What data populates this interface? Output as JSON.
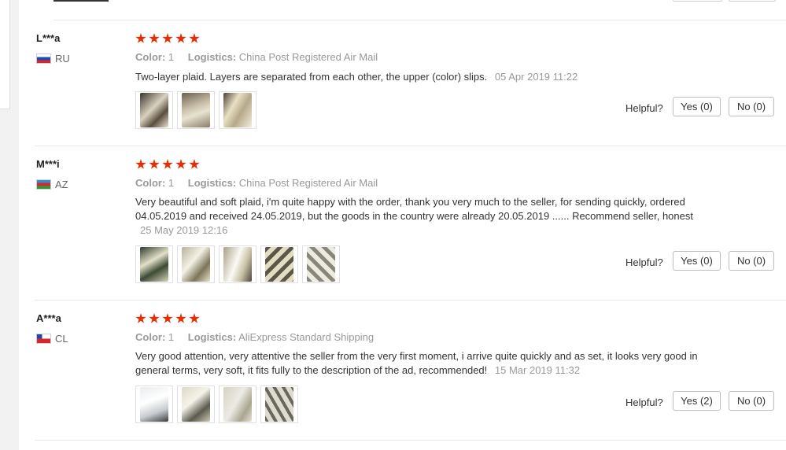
{
  "reviews": [
    {
      "user": "L***a",
      "country": "RU",
      "rating_stars": 5,
      "color_label": "Color:",
      "color_value": "1",
      "logistics_label": "Logistics:",
      "logistics_value": "China Post Registered Air Mail",
      "text": "Two-layer plaid. Layers are separated from each other, the upper (color) slips.",
      "date": "05 Apr 2019 11:22",
      "photo_count": 3,
      "helpful_label": "Helpful?",
      "yes_label": "Yes (0)",
      "no_label": "No (0)"
    },
    {
      "user": "M***i",
      "country": "AZ",
      "rating_stars": 5,
      "color_label": "Color:",
      "color_value": "1",
      "logistics_label": "Logistics:",
      "logistics_value": "China Post Registered Air Mail",
      "text": "Very beautiful and soft plaid, i'm quite happy with the order, thank you very much to the seller, for sending quickly, ordered 04.05.2019 and received 24.05.2019, but the goods in the country were already 20.05.2019 ...... Recommend seller, honest",
      "date": "25 May 2019 12:16",
      "photo_count": 5,
      "helpful_label": "Helpful?",
      "yes_label": "Yes (0)",
      "no_label": "No (0)"
    },
    {
      "user": "A***a",
      "country": "CL",
      "rating_stars": 5,
      "color_label": "Color:",
      "color_value": "1",
      "logistics_label": "Logistics:",
      "logistics_value": "AliExpress Standard Shipping",
      "text": "Very good attention, very attentive the seller from the very first moment, i arrive quite quickly and as set, it looks very good in general terms, very soft, it fits fully to the description of the ad, recommended!",
      "date": "15 Mar 2019 11:32",
      "photo_count": 4,
      "helpful_label": "Helpful?",
      "yes_label": "Yes (2)",
      "no_label": "No (0)"
    }
  ],
  "colors": {
    "star": "#e62e04",
    "muted_text": "#999999",
    "body_text": "#333333"
  }
}
